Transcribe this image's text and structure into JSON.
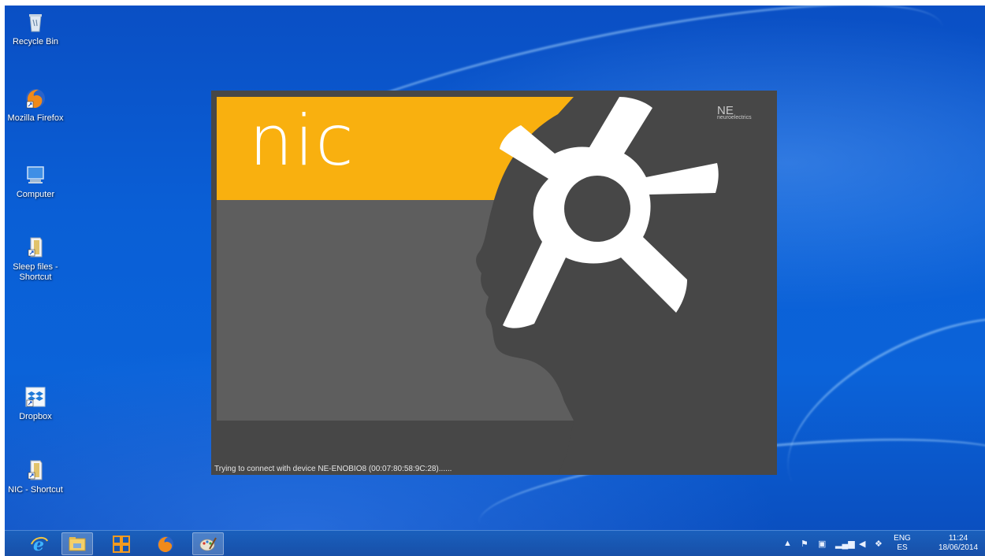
{
  "desktop_icons": [
    {
      "label": "Recycle Bin",
      "icon": "recycle-bin-icon"
    },
    {
      "label": "Mozilla Firefox",
      "icon": "firefox-icon"
    },
    {
      "label": "Computer",
      "icon": "computer-icon"
    },
    {
      "label": "Sleep files - Shortcut",
      "icon": "folder-shortcut-icon"
    },
    {
      "label": "Dropbox",
      "icon": "dropbox-icon"
    },
    {
      "label": "NIC - Shortcut",
      "icon": "nic-shortcut-icon"
    }
  ],
  "splash": {
    "title": "nic",
    "brand_mark": "NE",
    "brand_name": "neuroelectrics",
    "status": "Trying to connect with device NE-ENOBIO8 (00:07:80:58:9C:28)......",
    "colors": {
      "yellow": "#f9b00f",
      "dark": "#474747",
      "mid": "#5e5e5e",
      "logo": "#ffffff"
    }
  },
  "taskbar": {
    "apps": [
      {
        "name": "Internet Explorer",
        "icon": "internet-explorer-icon"
      },
      {
        "name": "File Explorer",
        "icon": "file-explorer-icon"
      },
      {
        "name": "Remote Desktop",
        "icon": "remote-app-icon"
      },
      {
        "name": "Firefox",
        "icon": "firefox-taskbar-icon"
      },
      {
        "name": "Paint",
        "icon": "paint-icon"
      }
    ],
    "tray": {
      "language_top": "ENG",
      "language_bottom": "ES",
      "time": "11:24",
      "date": "18/06/2014"
    }
  }
}
